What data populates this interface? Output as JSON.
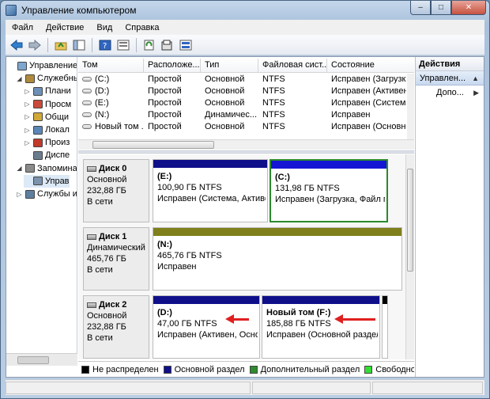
{
  "window": {
    "title": "Управление компьютером",
    "controls": {
      "minimize": "–",
      "maximize": "□",
      "close": "✕"
    }
  },
  "menu": [
    "Файл",
    "Действие",
    "Вид",
    "Справка"
  ],
  "tree": [
    {
      "label": "Управление к",
      "indent": 0,
      "icon": "computer-icon",
      "exp": ""
    },
    {
      "label": "Служебны",
      "indent": 1,
      "icon": "tools-icon",
      "exp": "◢"
    },
    {
      "label": "Плани",
      "indent": 2,
      "icon": "clock-icon",
      "exp": "▷"
    },
    {
      "label": "Просм",
      "indent": 2,
      "icon": "event-icon",
      "exp": "▷"
    },
    {
      "label": "Общи",
      "indent": 2,
      "icon": "share-icon",
      "exp": "▷"
    },
    {
      "label": "Локал",
      "indent": 2,
      "icon": "users-icon",
      "exp": "▷"
    },
    {
      "label": "Произ",
      "indent": 2,
      "icon": "perf-icon",
      "exp": "▷"
    },
    {
      "label": "Диспе",
      "indent": 2,
      "icon": "device-icon",
      "exp": ""
    },
    {
      "label": "Запомина",
      "indent": 1,
      "icon": "storage-icon",
      "exp": "◢"
    },
    {
      "label": "Управ",
      "indent": 2,
      "icon": "disk-mgmt-icon",
      "exp": "",
      "selected": true
    },
    {
      "label": "Службы и",
      "indent": 1,
      "icon": "services-icon",
      "exp": "▷"
    }
  ],
  "volumes": {
    "columns": [
      "Том",
      "Расположе...",
      "Тип",
      "Файловая сист...",
      "Состояние"
    ],
    "rows": [
      [
        "(C:)",
        "Простой",
        "Основной",
        "NTFS",
        "Исправен (Загрузка, "
      ],
      [
        "(D:)",
        "Простой",
        "Основной",
        "NTFS",
        "Исправен (Активен, О"
      ],
      [
        "(E:)",
        "Простой",
        "Основной",
        "NTFS",
        "Исправен (Система, А"
      ],
      [
        "(N:)",
        "Простой",
        "Динамичес...",
        "NTFS",
        "Исправен"
      ],
      [
        "Новый том ...",
        "Простой",
        "Основной",
        "NTFS",
        "Исправен (Основной"
      ]
    ]
  },
  "disks": [
    {
      "name": "Диск 0",
      "type": "Основной",
      "size": "232,88 ГБ",
      "status": "В сети",
      "partitions": [
        {
          "name": "(E:)",
          "size": "100,90 ГБ NTFS",
          "status": "Исправен (Система, Активен",
          "bar": "#0f0f8a",
          "selected": false
        },
        {
          "name": "(C:)",
          "size": "131,98 ГБ NTFS",
          "status": "Исправен (Загрузка, Файл п",
          "bar": "#1515d4",
          "selected": true
        }
      ]
    },
    {
      "name": "Диск 1",
      "type": "Динамический",
      "size": "465,76 ГБ",
      "status": "В сети",
      "partitions": [
        {
          "name": "(N:)",
          "size": "465,76 ГБ NTFS",
          "status": "Исправен",
          "bar": "#7f7f1c",
          "selected": false
        }
      ]
    },
    {
      "name": "Диск 2",
      "type": "Основной",
      "size": "232,88 ГБ",
      "status": "В сети",
      "partitions": [
        {
          "name": "(D:)",
          "size": "47,00 ГБ NTFS",
          "status": "Исправен (Активен, Основ",
          "bar": "#0f0f8a",
          "selected": false
        },
        {
          "name": "Новый том  (F:)",
          "size": "185,88 ГБ NTFS",
          "status": "Исправен (Основной раздел)",
          "bar": "#0f0f8a",
          "selected": false
        }
      ]
    }
  ],
  "legend": [
    {
      "label": "Не распределен",
      "color": "#000000"
    },
    {
      "label": "Основной раздел",
      "color": "#0f0f8a"
    },
    {
      "label": "Дополнительный раздел",
      "color": "#2e8b2e"
    },
    {
      "label": "Свободно",
      "color": "#33dd33"
    },
    {
      "label": "Ло",
      "color": "#1515d4"
    }
  ],
  "actions": {
    "header": "Действия",
    "items": [
      {
        "label": "Управлен...",
        "chev": "▲",
        "selected": true
      },
      {
        "label": "Допо...",
        "chev": "▶",
        "selected": false
      }
    ]
  }
}
